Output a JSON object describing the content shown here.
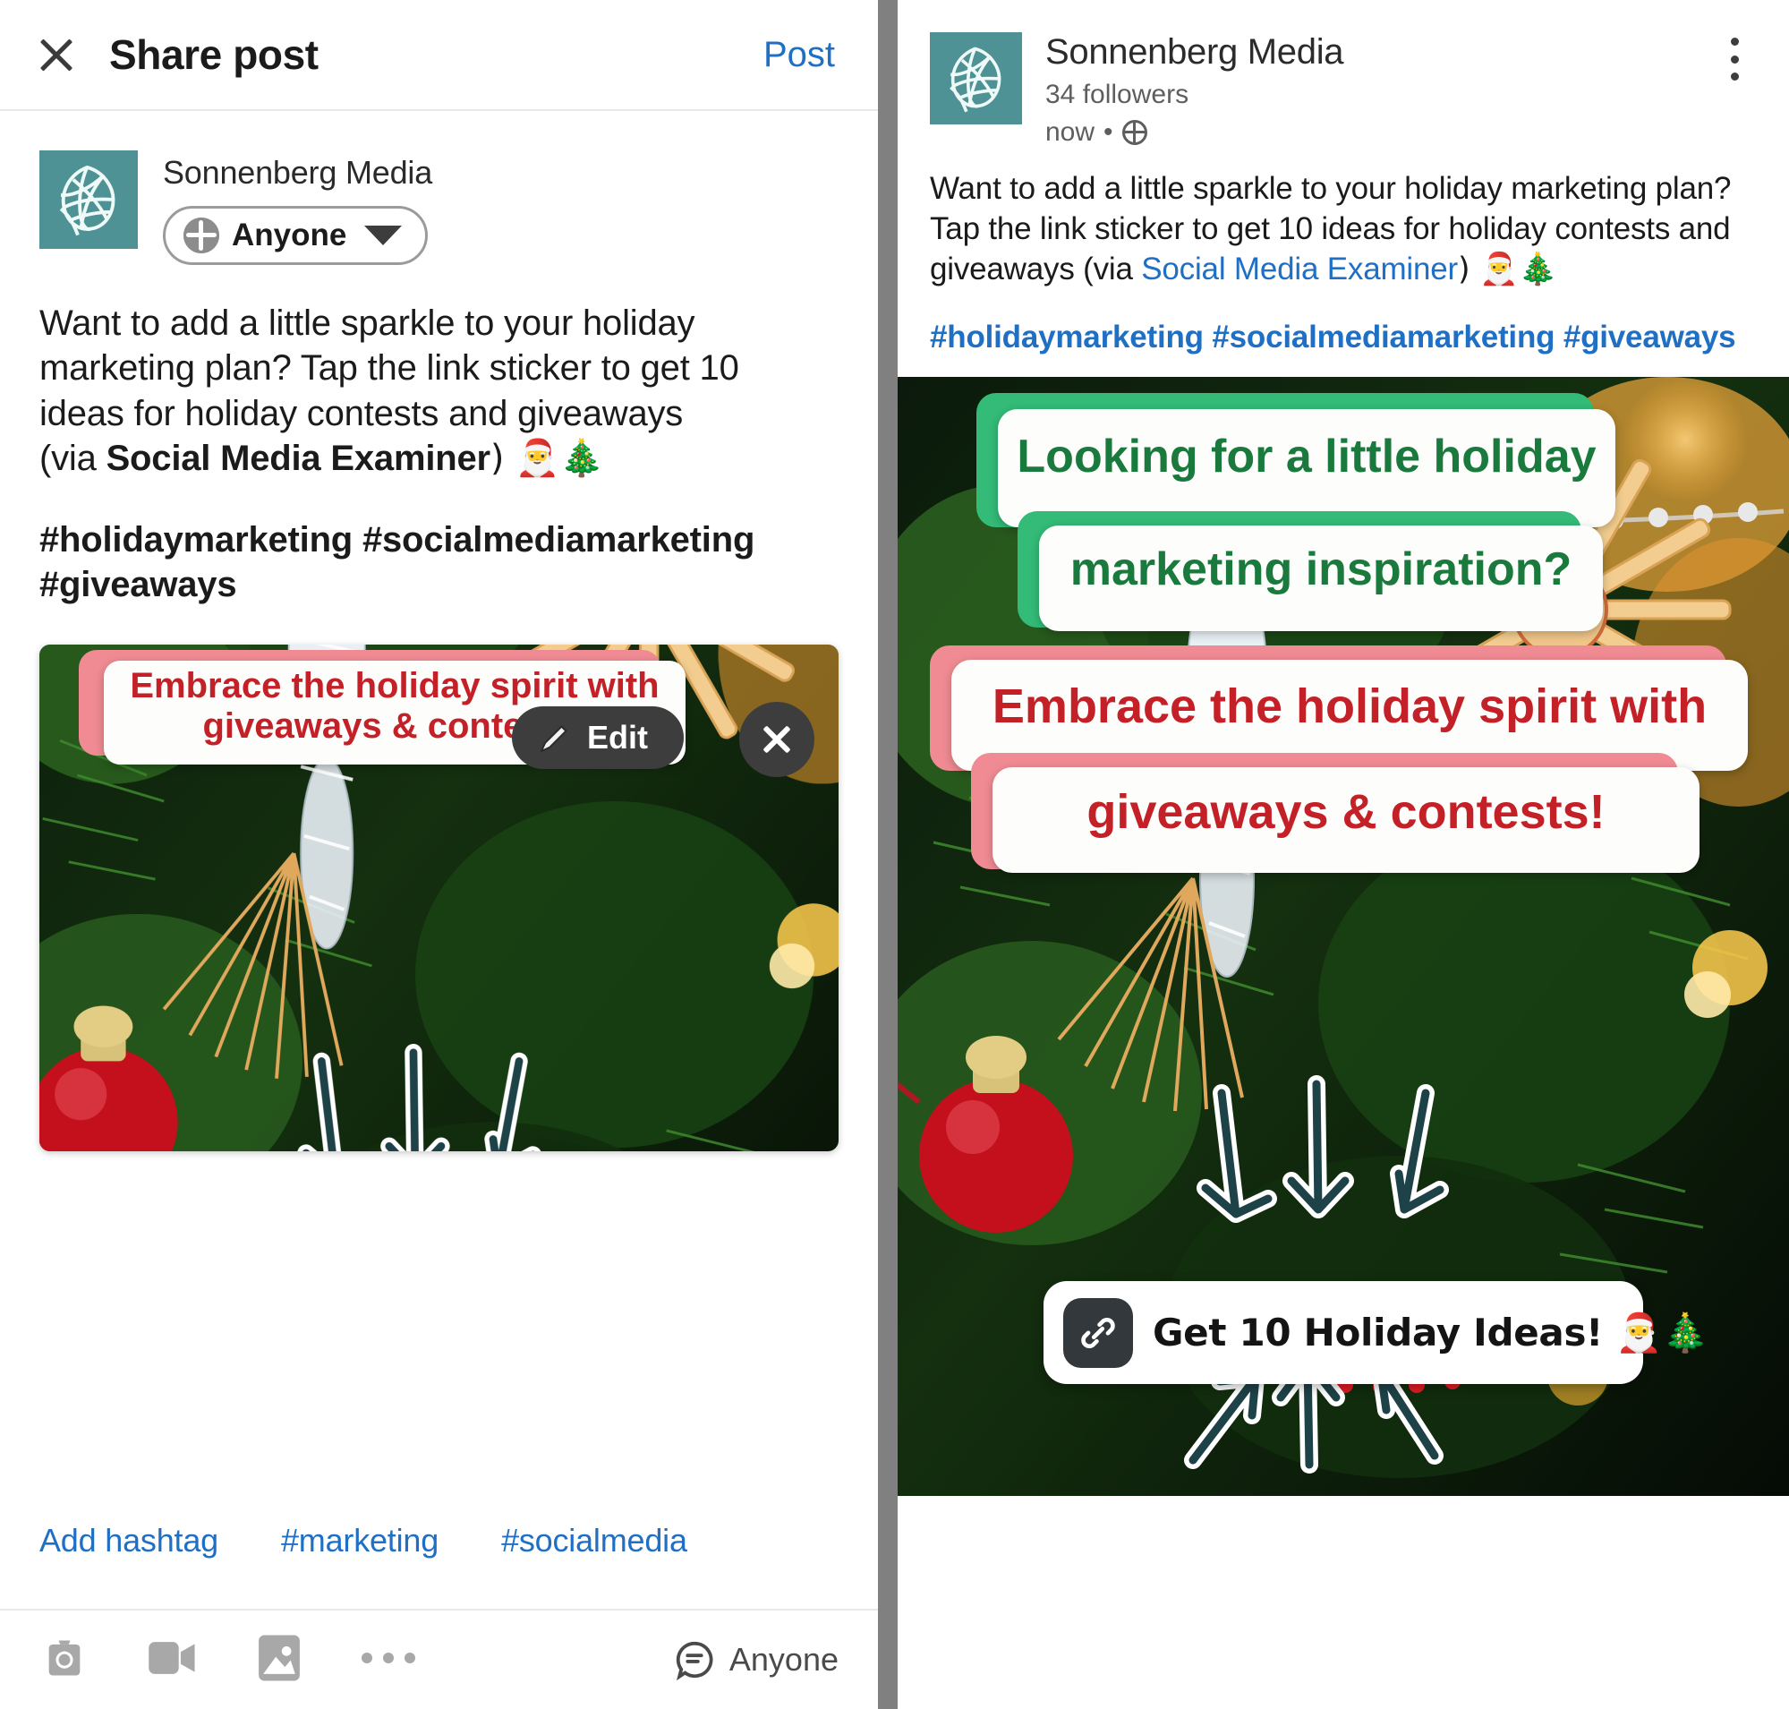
{
  "composer": {
    "close_icon": "close-icon",
    "title": "Share post",
    "post_label": "Post",
    "author": {
      "name": "Sonnenberg Media",
      "avatar_icon": "sonnenberg-leaf-logo",
      "audience_label": "Anyone",
      "audience_icon": "globe-icon",
      "caret_icon": "chevron-down-icon"
    },
    "text": {
      "line1": "Want to add a little sparkle to your holiday",
      "line2": "marketing plan? Tap the link sticker to get 10",
      "line3": "ideas for holiday contests and giveaways",
      "line4_prefix": "(via ",
      "line4_bold": "Social Media Examiner",
      "line4_suffix": ") 🎅🎄",
      "hashtags_line1": "#holidaymarketing #socialmediamarketing",
      "hashtags_line2": "#giveaways"
    },
    "media": {
      "edit_label": "Edit",
      "edit_icon": "pencil-icon",
      "remove_icon": "close-icon"
    },
    "hashtag_suggestions": [
      "Add hashtag",
      "#marketing",
      "#socialmedia"
    ],
    "toolbar": {
      "camera_icon": "camera-icon",
      "video_icon": "video-camera-icon",
      "image_icon": "image-icon",
      "more_icon": "ellipsis-icon",
      "comment_icon": "comment-bubble-icon",
      "comment_audience_label": "Anyone"
    }
  },
  "preview": {
    "author": {
      "name": "Sonnenberg Media",
      "avatar_icon": "sonnenberg-leaf-logo",
      "followers": "34 followers",
      "time": "now",
      "separator": "•",
      "visibility_icon": "globe-icon"
    },
    "menu_icon": "kebab-menu-icon",
    "text": {
      "line1": "Want to add a little sparkle to your holiday marketing plan?",
      "line2": "Tap the link sticker to get 10 ideas for holiday contests and",
      "line3_prefix": "giveaways (via ",
      "line3_link": "Social Media Examiner",
      "line3_suffix": ") 🎅🎄"
    },
    "hashtags": "#holidaymarketing #socialmediamarketing #giveaways",
    "story": {
      "green_sticker_line1": "Looking for a little holiday",
      "green_sticker_line2": "marketing inspiration?",
      "green_accent": "#33bb77",
      "green_text_color": "#1a7a3d",
      "red_sticker_line1": "Embrace the holiday spirit with",
      "red_sticker_line2": "giveaways & contests!",
      "red_accent": "#f08b93",
      "red_text_color": "#c32027",
      "link_sticker_label": "Get 10 Holiday Ideas! 🎅🎄",
      "link_sticker_icon": "link-chain-icon",
      "arrow_icon": "arrow-icon"
    }
  },
  "colors": {
    "brand_teal": "#4e9296",
    "link_blue": "#1f6fc4",
    "divider_gray": "#808080"
  }
}
